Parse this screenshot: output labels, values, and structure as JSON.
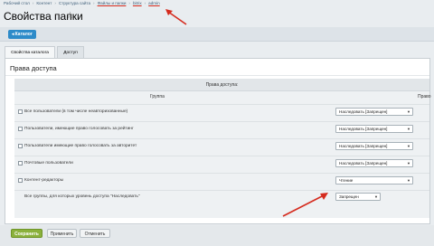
{
  "breadcrumb": {
    "items": [
      "Рабочий стол",
      "Контент",
      "Структура сайта",
      "Файлы и папки",
      "bitrix",
      "admin"
    ],
    "separator": "›"
  },
  "page": {
    "title": "Свойства папки",
    "star_icon": "star-outline-icon"
  },
  "toolbar": {
    "catalog_label": "Каталог",
    "catalog_icon": "arrow-left-icon"
  },
  "tabs": [
    {
      "label": "Свойства каталога",
      "active": false
    },
    {
      "label": "Доступ",
      "active": true
    }
  ],
  "access": {
    "section_title": "Права доступа",
    "table_header": "Права доступа:",
    "col_group": "Группа",
    "col_right": "Право",
    "rows": [
      {
        "label": "Все пользователи (в том числе неавторизованные)",
        "value": "Наследовать [Запрещен]",
        "checkbox": true
      },
      {
        "label": "Пользователи, имеющие право голосовать за рейтинг",
        "value": "Наследовать [Запрещен]",
        "checkbox": true
      },
      {
        "label": "Пользователи имеющие право голосовать за авторитет",
        "value": "Наследовать [Запрещен]",
        "checkbox": true
      },
      {
        "label": "Почтовые пользователи",
        "value": "Наследовать [Запрещен]",
        "checkbox": true
      },
      {
        "label": "Контент-редакторы",
        "value": "Чтение",
        "checkbox": true
      },
      {
        "label": "Все группы, для которых уровень доступа \"Наследовать\"",
        "value": "Запрещен",
        "checkbox": false
      }
    ]
  },
  "buttons": {
    "save": "Сохранить",
    "apply": "Применить",
    "cancel": "Отменить"
  },
  "colors": {
    "accent_blue": "#2d8bc9",
    "save_green": "#8bb13c",
    "annotation_red": "#d52b1e"
  }
}
